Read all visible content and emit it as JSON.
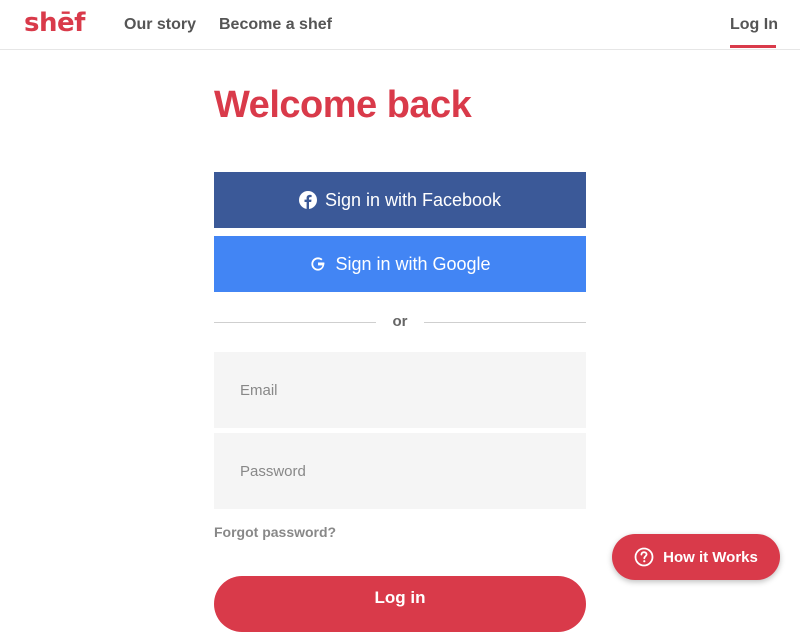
{
  "header": {
    "logo": "shēf",
    "nav": {
      "our_story": "Our story",
      "become_shef": "Become a shef"
    },
    "login": "Log In"
  },
  "main": {
    "title": "Welcome back",
    "facebook_label": "Sign in with Facebook",
    "google_label": "Sign in with Google",
    "divider": "or",
    "email_placeholder": "Email",
    "password_placeholder": "Password",
    "forgot_password": "Forgot password?",
    "login_button": "Log in"
  },
  "help": {
    "how_it_works": "How it Works"
  },
  "colors": {
    "brand_red": "#d93a4a",
    "facebook_blue": "#3b5998",
    "google_blue": "#4285f4"
  },
  "icons": {
    "facebook": "facebook-icon",
    "google": "google-icon",
    "help": "question-circle-icon"
  }
}
